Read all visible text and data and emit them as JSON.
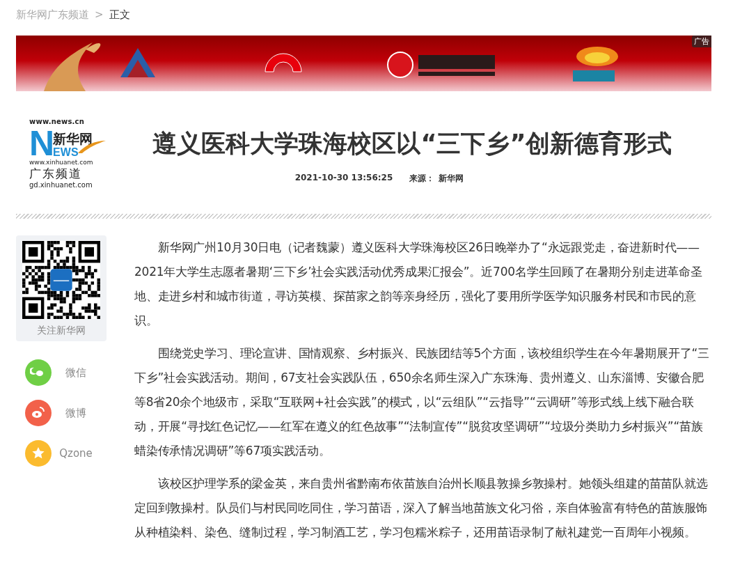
{
  "breadcrumb": {
    "items": [
      {
        "label": "新华网广东频道",
        "current": false
      },
      {
        "label": "正文",
        "current": true
      }
    ],
    "separator": ">"
  },
  "banner": {
    "kind": "picture",
    "ad_label": "广告"
  },
  "logo": {
    "domain": "www.news.cn",
    "name": "新华网",
    "mark_letter": "N",
    "mark_rest": "EWS",
    "site": "www.xinhuanet.com",
    "channel": "广东频道",
    "channel_site": "gd.xinhuanet.com"
  },
  "article": {
    "title": "遵义医科大学珠海校区以“三下乡”创新德育形式",
    "datetime": "2021-10-30 13:56:25",
    "source_label": "来源：",
    "source": "新华网",
    "paragraphs": [
      "新华网广州10月30日电（记者魏蒙）遵义医科大学珠海校区26日晚举办了“永远跟党走，奋进新时代——2021年大学生志愿者暑期‘三下乡’社会实践活动优秀成果汇报会”。近700名学生回顾了在暑期分别走进革命圣地、走进乡村和城市街道，寻访英模、探苗家之韵等亲身经历，强化了要用所学医学知识服务村民和市民的意识。",
      "围绕党史学习、理论宣讲、国情观察、乡村振兴、民族团结等5个方面，该校组织学生在今年暑期展开了“三下乡”社会实践活动。期间，67支社会实践队伍，650余名师生深入广东珠海、贵州遵义、山东淄博、安徽合肥等8省20余个地级市，采取“互联网+社会实践”的模式，以“云组队”“云指导”“云调研”等形式线上线下融合联动，开展“寻找红色记忆——红军在遵义的红色故事”“法制宣传”“脱贫攻坚调研”“垃圾分类助力乡村振兴”“苗族蜡染传承情况调研”等67项实践活动。",
      "该校区护理学系的梁金英，来自贵州省黔南布依苗族自治州长顺县敦操乡敦操村。她领头组建的苗苗队就选定回到敦操村。队员们与村民同吃同住，学习苗语，深入了解当地苗族文化习俗，亲自体验富有特色的苗族服饰从种植染料、染色、缝制过程，学习制酒工艺，学习包糯米粽子，还用苗语录制了献礼建党一百周年小视频。"
    ]
  },
  "sidebar": {
    "qr_caption": "关注新华网",
    "share": [
      {
        "kind": "wechat",
        "label": "微信"
      },
      {
        "kind": "weibo",
        "label": "微博"
      },
      {
        "kind": "qzone",
        "label": "Qzone"
      }
    ]
  }
}
